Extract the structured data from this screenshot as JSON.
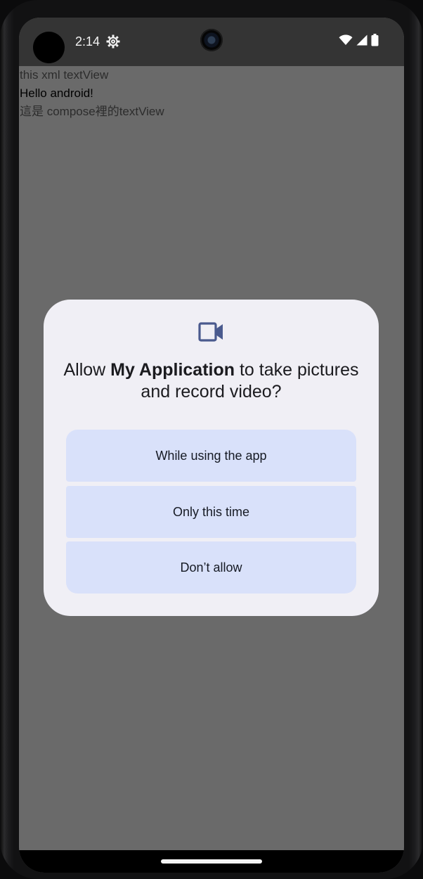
{
  "status_bar": {
    "time": "2:14",
    "icons": [
      "gear-icon",
      "wifi-icon",
      "signal-icon",
      "battery-icon"
    ]
  },
  "app": {
    "lines": [
      "this xml textView",
      "Hello android!",
      "這是 compose裡的textView"
    ]
  },
  "permission_dialog": {
    "icon": "videocam-icon",
    "title_prefix": "Allow ",
    "app_name": "My Application",
    "title_suffix": " to take pictures and record video?",
    "buttons": {
      "while_using": "While using the app",
      "only_this_time": "Only this time",
      "dont_allow": "Don’t allow"
    }
  },
  "colors": {
    "scrim": "#6a6a6a",
    "dialog_background": "#f0eff5",
    "button_background": "#d9e1fa",
    "icon_accent": "#4a5a8e"
  }
}
